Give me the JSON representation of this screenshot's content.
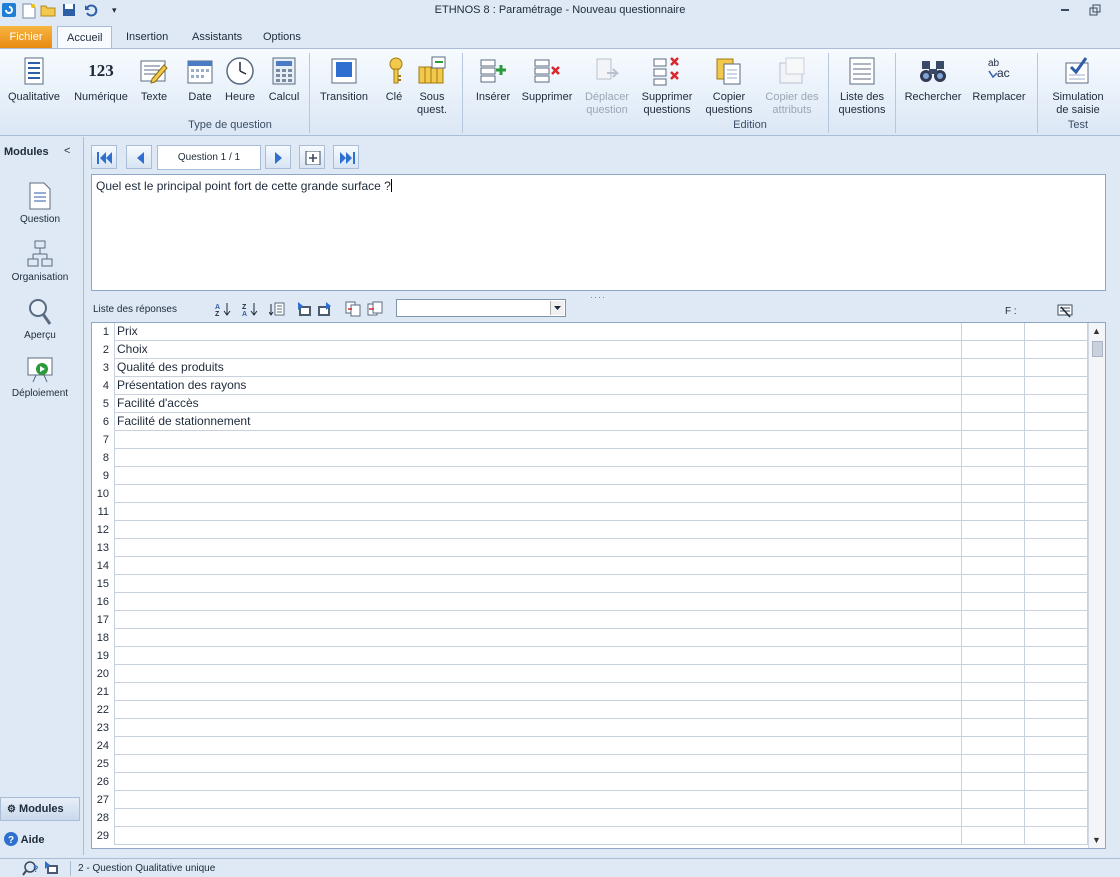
{
  "window": {
    "title": "ETHNOS 8 : Paramétrage - Nouveau questionnaire"
  },
  "tabs": [
    {
      "label": "Fichier"
    },
    {
      "label": "Accueil"
    },
    {
      "label": "Insertion"
    },
    {
      "label": "Assistants"
    },
    {
      "label": "Options"
    }
  ],
  "ribbon": {
    "type_question": {
      "group_label": "Type de question",
      "qualitative": "Qualitative",
      "numerique": "Numérique",
      "numerique_icon_text": "123",
      "texte": "Texte",
      "date": "Date",
      "heure": "Heure",
      "calcul": "Calcul",
      "transition": "Transition",
      "cle": "Clé",
      "sous_quest_1": "Sous",
      "sous_quest_2": "quest."
    },
    "edition": {
      "group_label": "Edition",
      "inserer": "Insérer",
      "supprimer": "Supprimer",
      "deplacer_1": "Déplacer",
      "deplacer_2": "question",
      "supprimer_q_1": "Supprimer",
      "supprimer_q_2": "questions",
      "copier_q_1": "Copier",
      "copier_q_2": "questions",
      "copier_attr_1": "Copier des",
      "copier_attr_2": "attributs",
      "liste_q_1": "Liste des",
      "liste_q_2": "questions",
      "rechercher": "Rechercher",
      "remplacer": "Remplacer",
      "remplacer_icon_top": "ab",
      "remplacer_icon_bottom": "ac"
    },
    "test": {
      "group_label": "Test",
      "simulation_1": "Simulation",
      "simulation_2": "de saisie"
    }
  },
  "modules": {
    "header": "Modules",
    "collapse": "<",
    "items": [
      {
        "label": "Question"
      },
      {
        "label": "Organisation"
      },
      {
        "label": "Aperçu"
      },
      {
        "label": "Déploiement"
      }
    ],
    "modules_button": "Modules",
    "aide_button": "Aide"
  },
  "navigator": {
    "counter": "Question 1 / 1"
  },
  "question": {
    "text": "Quel est le principal point fort de cette grande surface ?"
  },
  "responses": {
    "label": "Liste des réponses",
    "dropdown_value": "",
    "f_label": "F :",
    "rows": [
      {
        "num": "1",
        "text": "Prix"
      },
      {
        "num": "2",
        "text": "Choix"
      },
      {
        "num": "3",
        "text": "Qualité des produits"
      },
      {
        "num": "4",
        "text": "Présentation des rayons"
      },
      {
        "num": "5",
        "text": "Facilité d'accès"
      },
      {
        "num": "6",
        "text": "Facilité de stationnement"
      },
      {
        "num": "7",
        "text": ""
      },
      {
        "num": "8",
        "text": ""
      },
      {
        "num": "9",
        "text": ""
      },
      {
        "num": "10",
        "text": ""
      },
      {
        "num": "11",
        "text": ""
      },
      {
        "num": "12",
        "text": ""
      },
      {
        "num": "13",
        "text": ""
      },
      {
        "num": "14",
        "text": ""
      },
      {
        "num": "15",
        "text": ""
      },
      {
        "num": "16",
        "text": ""
      },
      {
        "num": "17",
        "text": ""
      },
      {
        "num": "18",
        "text": ""
      },
      {
        "num": "19",
        "text": ""
      },
      {
        "num": "20",
        "text": ""
      },
      {
        "num": "21",
        "text": ""
      },
      {
        "num": "22",
        "text": ""
      },
      {
        "num": "23",
        "text": ""
      },
      {
        "num": "24",
        "text": ""
      },
      {
        "num": "25",
        "text": ""
      },
      {
        "num": "26",
        "text": ""
      },
      {
        "num": "27",
        "text": ""
      },
      {
        "num": "28",
        "text": ""
      },
      {
        "num": "29",
        "text": ""
      }
    ]
  },
  "status": {
    "text": "2 - Question Qualitative  unique"
  }
}
